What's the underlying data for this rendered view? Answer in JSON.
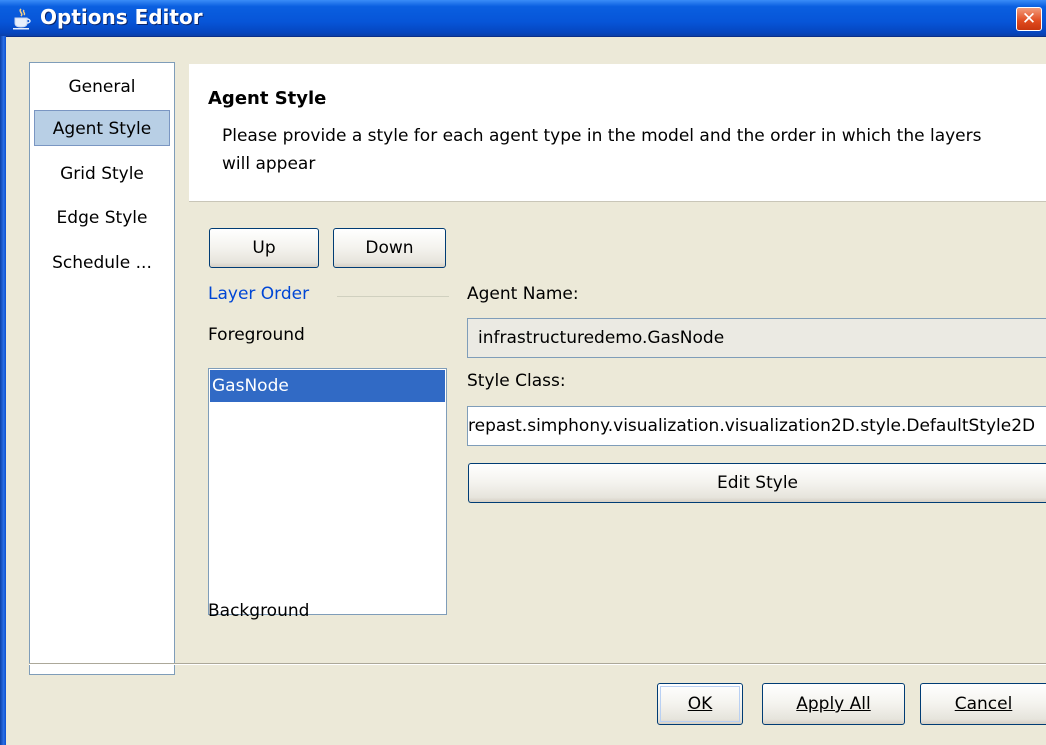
{
  "window": {
    "title": "Options Editor",
    "close_glyph": "✕",
    "icon": "java-cup-icon"
  },
  "nav": {
    "items": [
      {
        "label": "General",
        "selected": false
      },
      {
        "label": "Agent Style",
        "selected": true
      },
      {
        "label": "Grid Style",
        "selected": false
      },
      {
        "label": "Edge Style",
        "selected": false
      },
      {
        "label": "Schedule ...",
        "selected": false
      }
    ]
  },
  "header": {
    "title": "Agent Style",
    "description": "Please provide a style for each agent type in the model and the order in which the layers will appear"
  },
  "layer": {
    "up_label": "Up",
    "down_label": "Down",
    "order_label": "Layer Order",
    "foreground_label": "Foreground",
    "background_label": "Background",
    "items": [
      "GasNode"
    ]
  },
  "agent": {
    "name_label": "Agent Name:",
    "name_value": "infrastructuredemo.GasNode",
    "style_class_label": "Style Class:",
    "style_class_value": "repast.simphony.visualization.visualization2D.style.DefaultStyle2D",
    "edit_style_label": "Edit Style"
  },
  "footer": {
    "ok_label": "OK",
    "apply_all_label": "Apply All",
    "cancel_label": "Cancel"
  },
  "colors": {
    "titlebar": "#0755d8",
    "dialog_bg": "#ece9d8",
    "selection": "#316ac5",
    "link_label": "#0046d5"
  }
}
